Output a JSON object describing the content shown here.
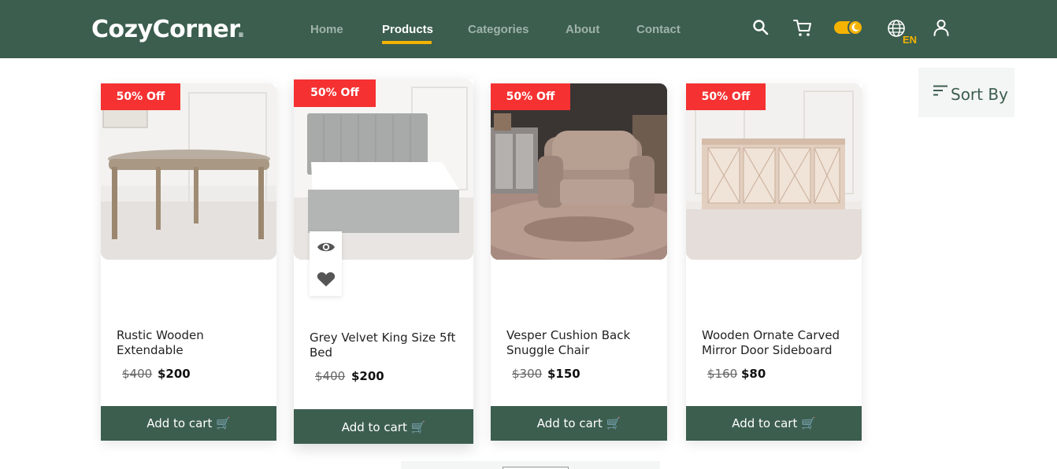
{
  "header": {
    "brand": "CozyCorner",
    "brand_dot": ".",
    "nav": [
      {
        "label": "Home",
        "active": false
      },
      {
        "label": "Products",
        "active": true
      },
      {
        "label": "Categories",
        "active": false
      },
      {
        "label": "About",
        "active": false
      },
      {
        "label": "Contact",
        "active": false
      }
    ],
    "language": "EN",
    "icons": [
      "search-icon",
      "cart-icon",
      "theme-toggle",
      "globe-icon",
      "user-icon"
    ]
  },
  "sort": {
    "label": "Sort By",
    "icon": "sort-icon"
  },
  "products": [
    {
      "badge": "50% Off",
      "title": "Rustic Wooden Extendable",
      "old_price": "$400",
      "price": "$200",
      "button": "Add to cart"
    },
    {
      "badge": "50% Off",
      "title": "Grey Velvet King Size 5ft Bed",
      "old_price": "$400",
      "price": "$200",
      "button": "Add to cart"
    },
    {
      "badge": "50% Off",
      "title": "Vesper Cushion Back Snuggle Chair",
      "old_price": "$300",
      "price": "$150",
      "button": "Add to cart"
    },
    {
      "badge": "50% Off",
      "title": "Wooden Ornate Carved Mirror Door Sideboard",
      "old_price": "$160",
      "price": "$80",
      "button": "Add to cart"
    }
  ],
  "quick_actions": [
    "eye-icon",
    "heart-icon"
  ],
  "colors": {
    "header_bg": "#3c5e4f",
    "accent": "#f5b301",
    "badge": "#f53131",
    "button_bg": "#3c5e4f"
  }
}
